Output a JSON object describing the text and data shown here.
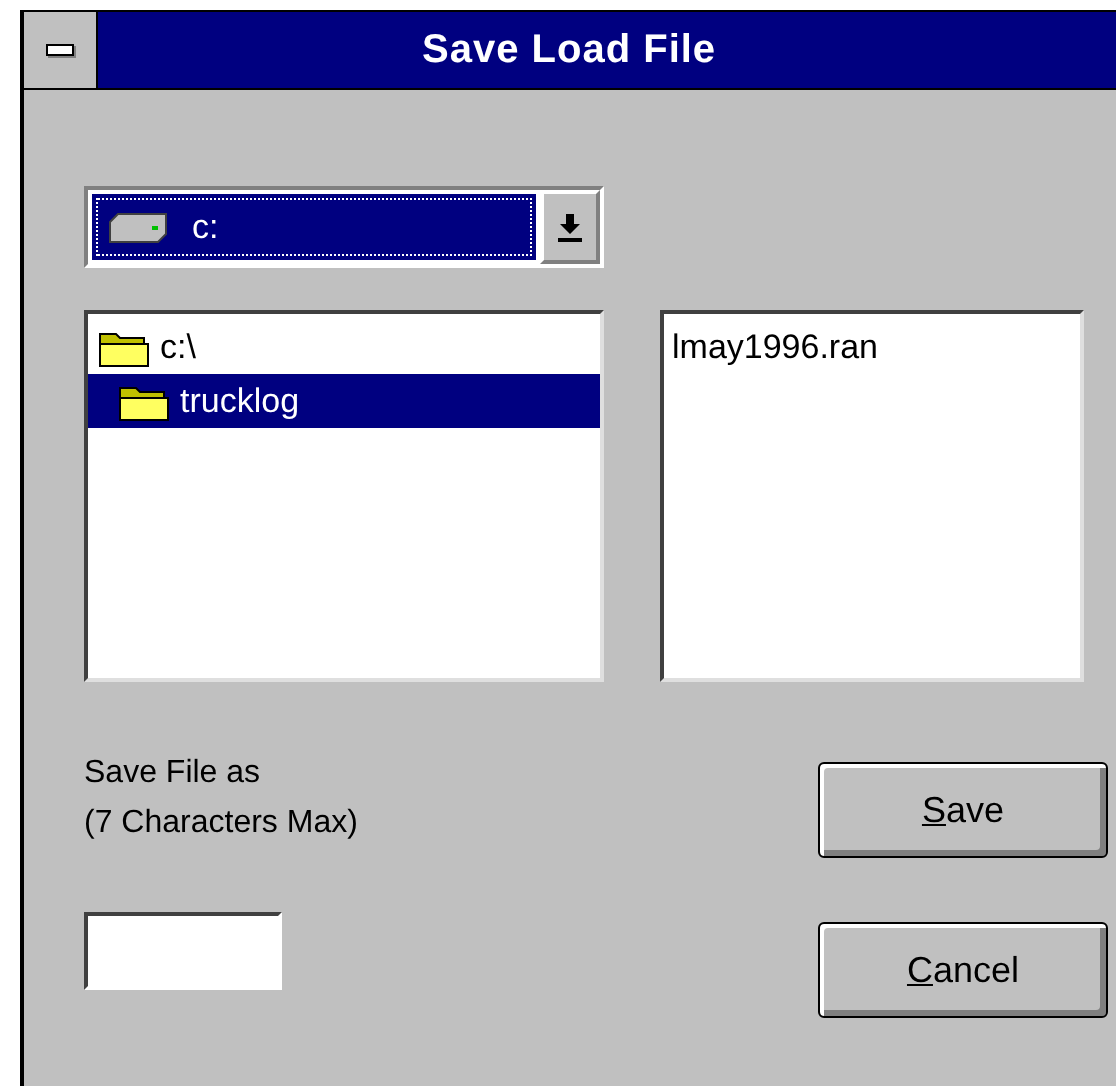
{
  "window": {
    "title": "Save Load File"
  },
  "drive": {
    "value": "c:",
    "focused": true
  },
  "directories": [
    {
      "label": "c:\\",
      "selected": false,
      "children": [
        {
          "label": "trucklog",
          "selected": true
        }
      ]
    }
  ],
  "files": [
    {
      "label": "lmay1996.ran",
      "selected": false
    }
  ],
  "save_as": {
    "label": "Save File as",
    "hint": "(7 Characters Max)"
  },
  "buttons": [
    {
      "label": "Save",
      "mnemonic_first": true
    },
    {
      "label": "Cancel",
      "mnemonic_first": true
    }
  ]
}
